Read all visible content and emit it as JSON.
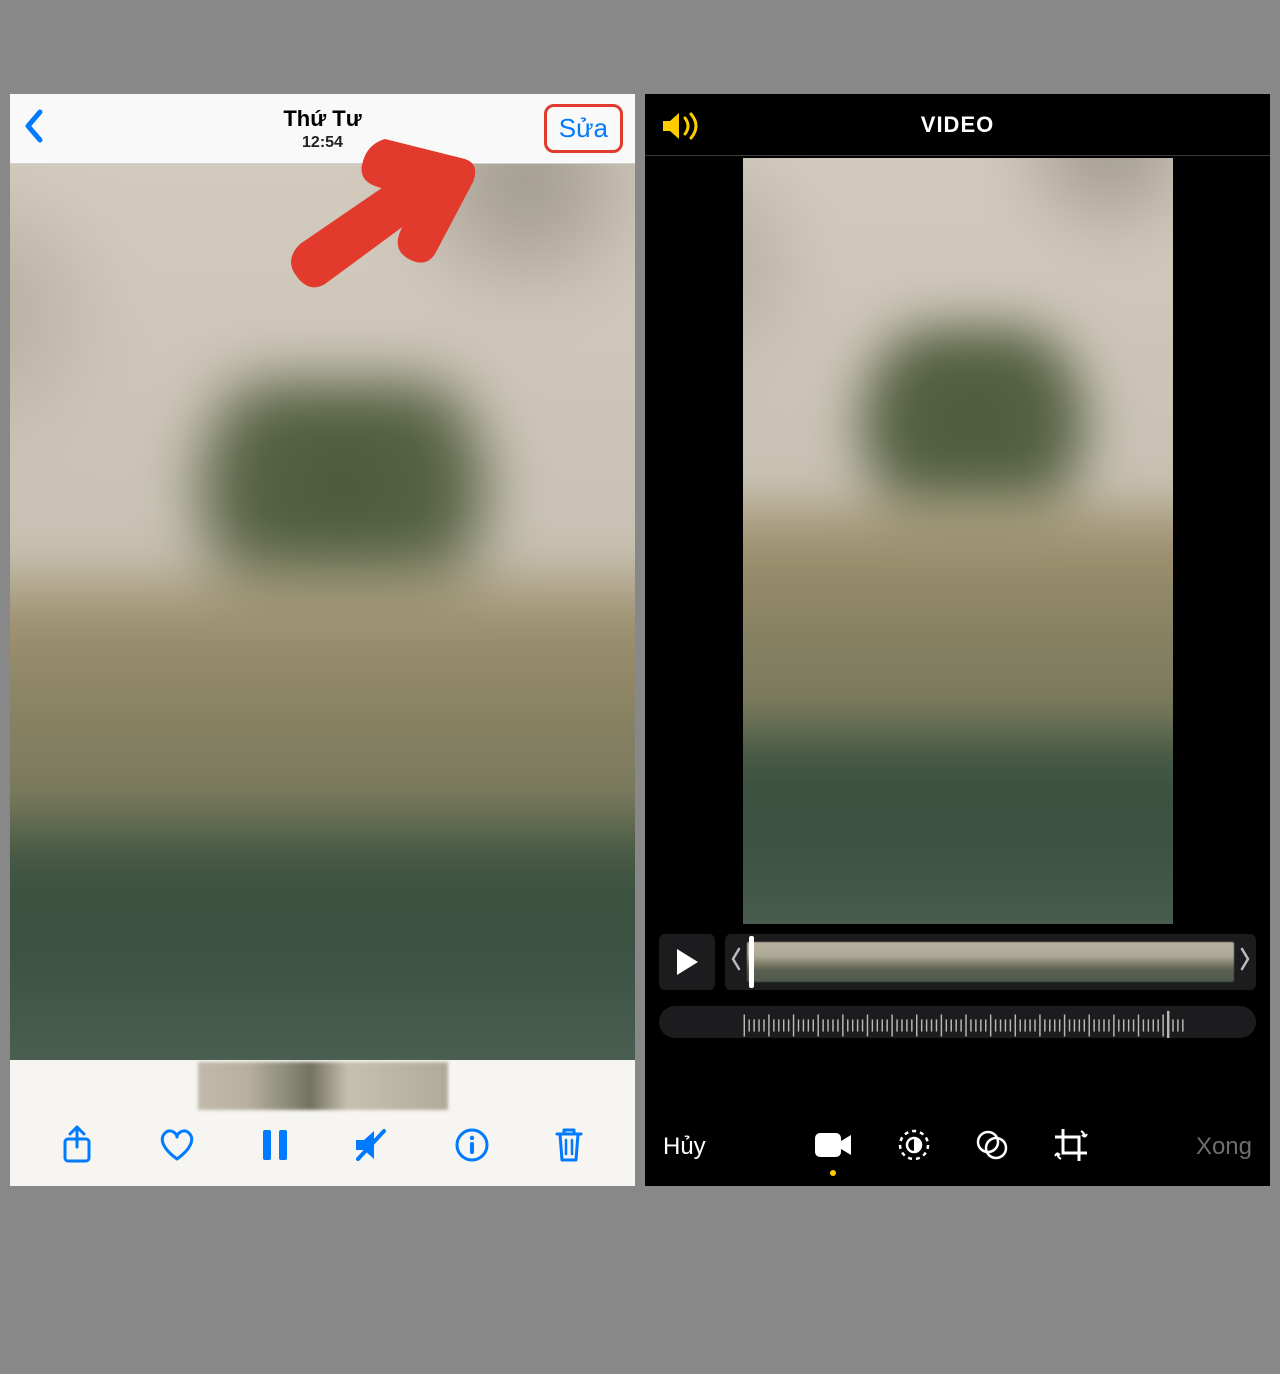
{
  "left": {
    "header": {
      "day": "Thứ Tư",
      "time": "12:54",
      "edit_label": "Sửa"
    }
  },
  "right": {
    "header": {
      "title": "VIDEO"
    },
    "footer": {
      "cancel": "Hủy",
      "done": "Xong"
    }
  }
}
